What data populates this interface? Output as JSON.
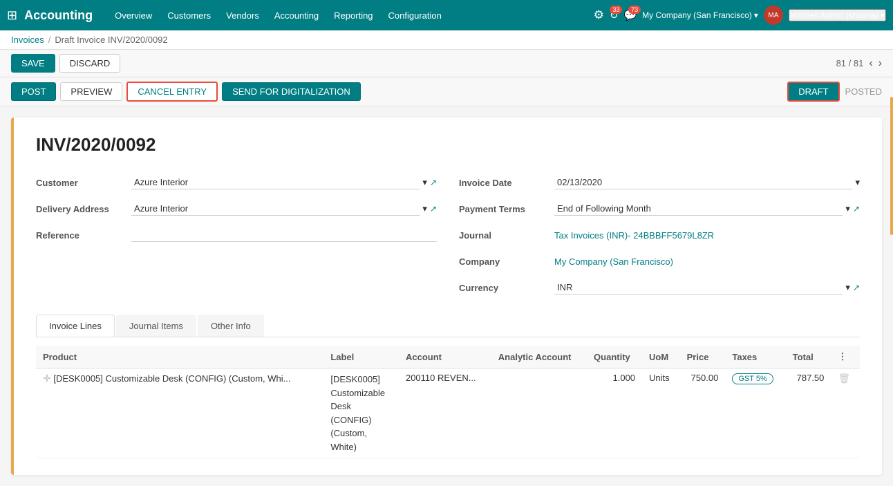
{
  "app": {
    "title": "Accounting",
    "grid_icon": "⊞"
  },
  "nav": {
    "items": [
      {
        "label": "Overview",
        "id": "overview"
      },
      {
        "label": "Customers",
        "id": "customers"
      },
      {
        "label": "Vendors",
        "id": "vendors"
      },
      {
        "label": "Accounting",
        "id": "accounting"
      },
      {
        "label": "Reporting",
        "id": "reporting"
      },
      {
        "label": "Configuration",
        "id": "configuration"
      }
    ]
  },
  "nav_right": {
    "bug_icon": "🐞",
    "clock_badge": "33",
    "chat_badge": "73",
    "company": "My Company (San Francisco)",
    "user": "Mitchell Admin (shabna)"
  },
  "breadcrumb": {
    "parent": "Invoices",
    "separator": "/",
    "current": "Draft Invoice INV/2020/0092"
  },
  "action_bar": {
    "save_label": "SAVE",
    "discard_label": "DISCARD",
    "pagination": "81 / 81"
  },
  "status_bar": {
    "post_label": "POST",
    "preview_label": "PREVIEW",
    "cancel_entry_label": "CANCEL ENTRY",
    "send_digitalization_label": "SEND FOR DIGITALIZATION",
    "draft_label": "DRAFT",
    "posted_label": "POSTED"
  },
  "invoice": {
    "number": "INV/2020/0092",
    "fields": {
      "customer_label": "Customer",
      "customer_value": "Azure Interior",
      "delivery_address_label": "Delivery Address",
      "delivery_address_value": "Azure Interior",
      "reference_label": "Reference",
      "reference_value": "",
      "invoice_date_label": "Invoice Date",
      "invoice_date_value": "02/13/2020",
      "payment_terms_label": "Payment Terms",
      "payment_terms_value": "End of Following Month",
      "journal_label": "Journal",
      "journal_value": "Tax Invoices (INR)- 24BBBFF5679L8ZR",
      "company_label": "Company",
      "company_value": "My Company (San Francisco)",
      "currency_label": "Currency",
      "currency_value": "INR"
    },
    "tabs": [
      {
        "label": "Invoice Lines",
        "id": "invoice-lines",
        "active": true
      },
      {
        "label": "Journal Items",
        "id": "journal-items",
        "active": false
      },
      {
        "label": "Other Info",
        "id": "other-info",
        "active": false
      }
    ],
    "table": {
      "columns": [
        {
          "label": "Product",
          "id": "product"
        },
        {
          "label": "Label",
          "id": "label"
        },
        {
          "label": "Account",
          "id": "account"
        },
        {
          "label": "Analytic Account",
          "id": "analytic-account"
        },
        {
          "label": "Quantity",
          "id": "quantity"
        },
        {
          "label": "UoM",
          "id": "uom"
        },
        {
          "label": "Price",
          "id": "price"
        },
        {
          "label": "Taxes",
          "id": "taxes"
        },
        {
          "label": "Total",
          "id": "total"
        }
      ],
      "rows": [
        {
          "product": "[DESK0005] Customizable Desk (CONFIG) (Custom, Whi...",
          "label_line1": "[DESK0005]",
          "label_line2": "Customizable",
          "label_line3": "Desk",
          "label_line4": "(CONFIG)",
          "label_line5": "(Custom,",
          "label_line6": "White)",
          "account": "200110 REVEN...",
          "analytic_account": "",
          "quantity": "1.000",
          "uom": "Units",
          "price": "750.00",
          "taxes": "GST 5%",
          "total": "787.50"
        }
      ]
    }
  }
}
